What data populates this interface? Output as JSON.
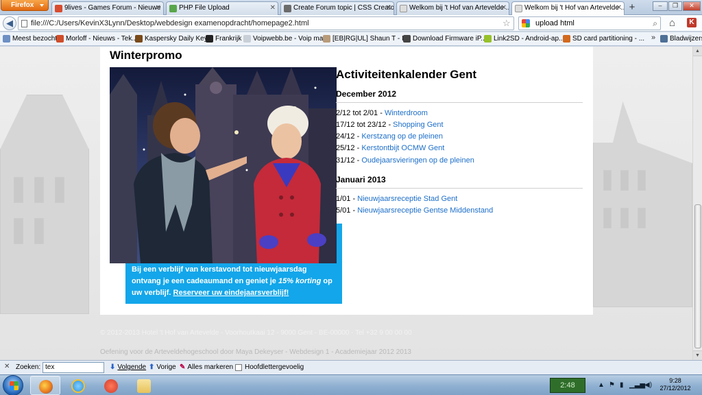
{
  "browser": {
    "menu_button": "Firefox",
    "tabs": [
      {
        "label": "9lives - Games Forum - Nieuwe ...",
        "color": "#d84b2f",
        "active": false
      },
      {
        "label": "PHP File Upload",
        "color": "#59a64a",
        "active": false
      },
      {
        "label": "Create Forum topic | CSS Creator",
        "color": "#6b6b6b",
        "active": false
      },
      {
        "label": "Welkom bij 't Hof van Artevelde ...",
        "color": "#dddddd",
        "active": false
      },
      {
        "label": "Welkom bij 't Hof van Artevelde ...",
        "color": "#dddddd",
        "active": true
      }
    ],
    "new_tab": "+",
    "window_buttons": {
      "minimize": "–",
      "restore": "❐",
      "close": "✕"
    },
    "url": "file:///C:/Users/KevinX3Lynn/Desktop/webdesign examenopdracht/homepage2.html",
    "search_value": "upload html",
    "bookmarks": [
      {
        "label": "Meest bezocht",
        "color": "#6d8fc4"
      },
      {
        "label": "Morloff - Nieuws - Tek...",
        "color": "#cf4d2b"
      },
      {
        "label": "Kaspersky Daily Keys",
        "color": "#7a4a1a"
      },
      {
        "label": "Frankrijk",
        "color": "#222222"
      },
      {
        "label": "Voipwebb.be - Voip ma...",
        "color": "#c9cfd6"
      },
      {
        "label": "[EB|RG|UL] Shaun T - I...",
        "color": "#b89b7a"
      },
      {
        "label": "Download Firmware iP...",
        "color": "#444444"
      },
      {
        "label": "Link2SD - Android-ap...",
        "color": "#97c12a"
      },
      {
        "label": "SD card partitioning - ...",
        "color": "#d2691e"
      }
    ],
    "bookmarks_more": "»",
    "bookmarks_folder": "Bladwijzers"
  },
  "page": {
    "promo": {
      "title": "Winterpromo",
      "text_1": "Bij een verblijf van kerstavond tot nieuwjaarsdag ontvang je een cadeaumand en geniet je ",
      "text_em": "15% korting",
      "text_2": " op uw verblijf. ",
      "link": "Reserveer uw eindejaarsverblijf!"
    },
    "calendar": {
      "title": "Activiteitenkalender Gent",
      "months": [
        {
          "name": "December 2012",
          "items": [
            {
              "date": "2/12 tot 2/01 - ",
              "link": "Winterdroom"
            },
            {
              "date": "17/12 tot 23/12 - ",
              "link": "Shopping Gent"
            },
            {
              "date": "24/12 - ",
              "link": "Kerstzang op de pleinen"
            },
            {
              "date": "25/12 - ",
              "link": "Kerstontbijt OCMW Gent"
            },
            {
              "date": "31/12 - ",
              "link": "Oudejaarsvieringen op de pleinen"
            }
          ]
        },
        {
          "name": "Januari 2013",
          "items": [
            {
              "date": "1/01 - ",
              "link": "Nieuwjaarsreceptie Stad Gent"
            },
            {
              "date": "5/01 - ",
              "link": "Nieuwjaarsreceptie Gentse Middenstand"
            }
          ]
        }
      ]
    },
    "copyright": "© 2012-2013 Hotel 't Hof van Artevelde - Voorhoutkaai 12 - 9000 Gent - BE-00000 - Tel +32 9 00 00 00",
    "credits": "Oefening voor de Arteveldehogeschool door Maya Dekeyser - Webdesign 1 - Academiejaar 2012 2013"
  },
  "findbar": {
    "close": "✕",
    "label": "Zoeken:",
    "value": "tex",
    "next": "Volgende",
    "prev": "Vorige",
    "highlight": "Alles markeren",
    "match_case": "Hoofdlettergevoelig"
  },
  "taskbar": {
    "gadget_time": "2:48",
    "time": "9:28",
    "date": "27/12/2012",
    "apps": [
      {
        "name": "firefox",
        "color": "#e8751a",
        "active": true
      },
      {
        "name": "internet-explorer",
        "color": "#2f8fe0",
        "active": false
      },
      {
        "name": "ccleaner",
        "color": "#d23a2a",
        "active": false
      },
      {
        "name": "explorer",
        "color": "#e8c25a",
        "active": false
      }
    ]
  }
}
